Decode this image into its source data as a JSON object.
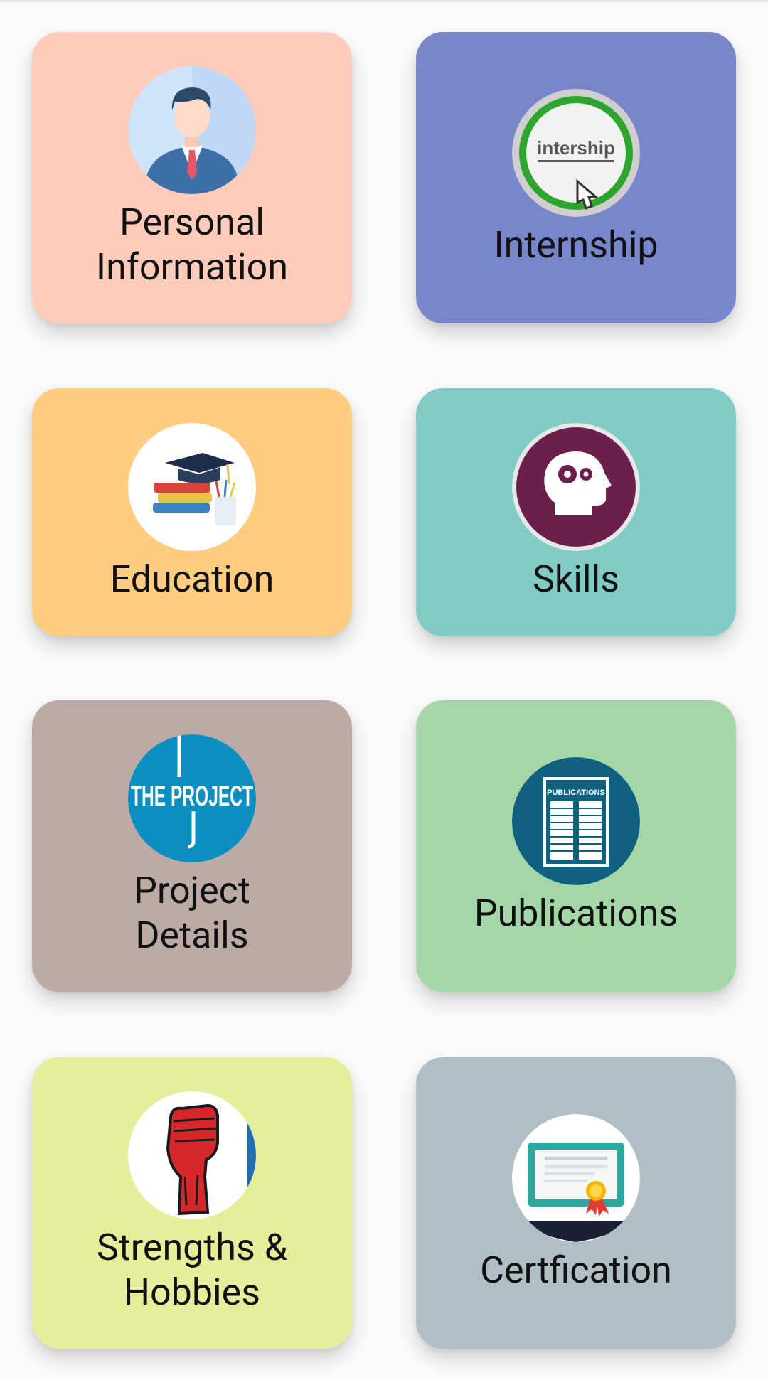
{
  "cards": [
    {
      "label": "Personal\nInformation",
      "color": "#ffccbc",
      "icon": "businessman-avatar-icon"
    },
    {
      "label": "Internship",
      "color": "#7986cb",
      "icon": "internship-button-icon",
      "icon_text": "intership"
    },
    {
      "label": "Education",
      "color": "#ffcc80",
      "icon": "graduation-books-icon"
    },
    {
      "label": "Skills",
      "color": "#80cbc4",
      "icon": "head-gears-icon"
    },
    {
      "label": "Project\nDetails",
      "color": "#bcaaa4",
      "icon": "the-project-logo-icon",
      "icon_text": "THE PROJECT"
    },
    {
      "label": "Publications",
      "color": "#a5d6a7",
      "icon": "publications-document-icon",
      "icon_text": "PUBLICATIONS"
    },
    {
      "label": "Strengths &\nHobbies",
      "color": "#e6ee9c",
      "icon": "raised-fist-icon"
    },
    {
      "label": "Certfication",
      "color": "#b0bec5",
      "icon": "certificate-icon"
    }
  ]
}
